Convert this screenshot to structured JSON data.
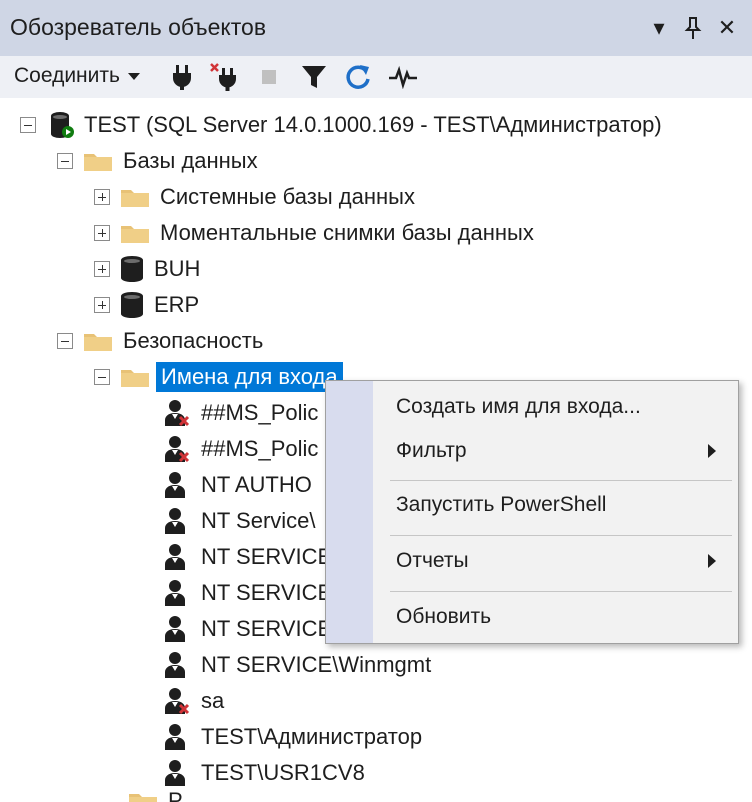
{
  "window": {
    "title": "Обозреватель объектов",
    "controls": [
      "▾",
      "⊥",
      "✕"
    ]
  },
  "toolbar": {
    "connect_label": "Соединить",
    "icons": [
      "connect-plug-icon",
      "disconnect-plug-icon",
      "stop-icon",
      "filter-icon",
      "refresh-icon",
      "activity-monitor-icon"
    ]
  },
  "tree": {
    "server": "TEST (SQL Server 14.0.1000.169 - TEST\\Администратор)",
    "databases": "Базы данных",
    "system_dbs": "Системные базы данных",
    "db_snapshots": "Моментальные снимки базы данных",
    "db_buh": "BUH",
    "db_erp": "ERP",
    "security": "Безопасность",
    "logins": "Имена для входа",
    "login_items": [
      {
        "name": "##MS_Polic",
        "disabled": true
      },
      {
        "name": "##MS_Polic",
        "disabled": true
      },
      {
        "name": "NT AUTHO",
        "disabled": false
      },
      {
        "name": "NT Service\\",
        "disabled": false
      },
      {
        "name": "NT SERVICE",
        "disabled": false
      },
      {
        "name": "NT SERVICE",
        "disabled": false
      },
      {
        "name": "NT SERVICE",
        "disabled": false
      },
      {
        "name": "NT SERVICE\\Winmgmt",
        "disabled": false
      },
      {
        "name": "sa",
        "disabled": true
      },
      {
        "name": "TEST\\Администратор",
        "disabled": false
      },
      {
        "name": "TEST\\USR1CV8",
        "disabled": false
      }
    ],
    "cut_off_item": "Р"
  },
  "context_menu": {
    "items": [
      "Создать имя для входа...",
      "Фильтр",
      "Запустить PowerShell",
      "Отчеты",
      "Обновить"
    ]
  },
  "colors": {
    "selection": "#0078d7",
    "title_bg": "#cfd6e5",
    "toolbar_bg": "#eef0f5",
    "menu_bg": "#f2f2f2",
    "menu_strip": "#d8dcee",
    "folder": "#e8c276"
  }
}
